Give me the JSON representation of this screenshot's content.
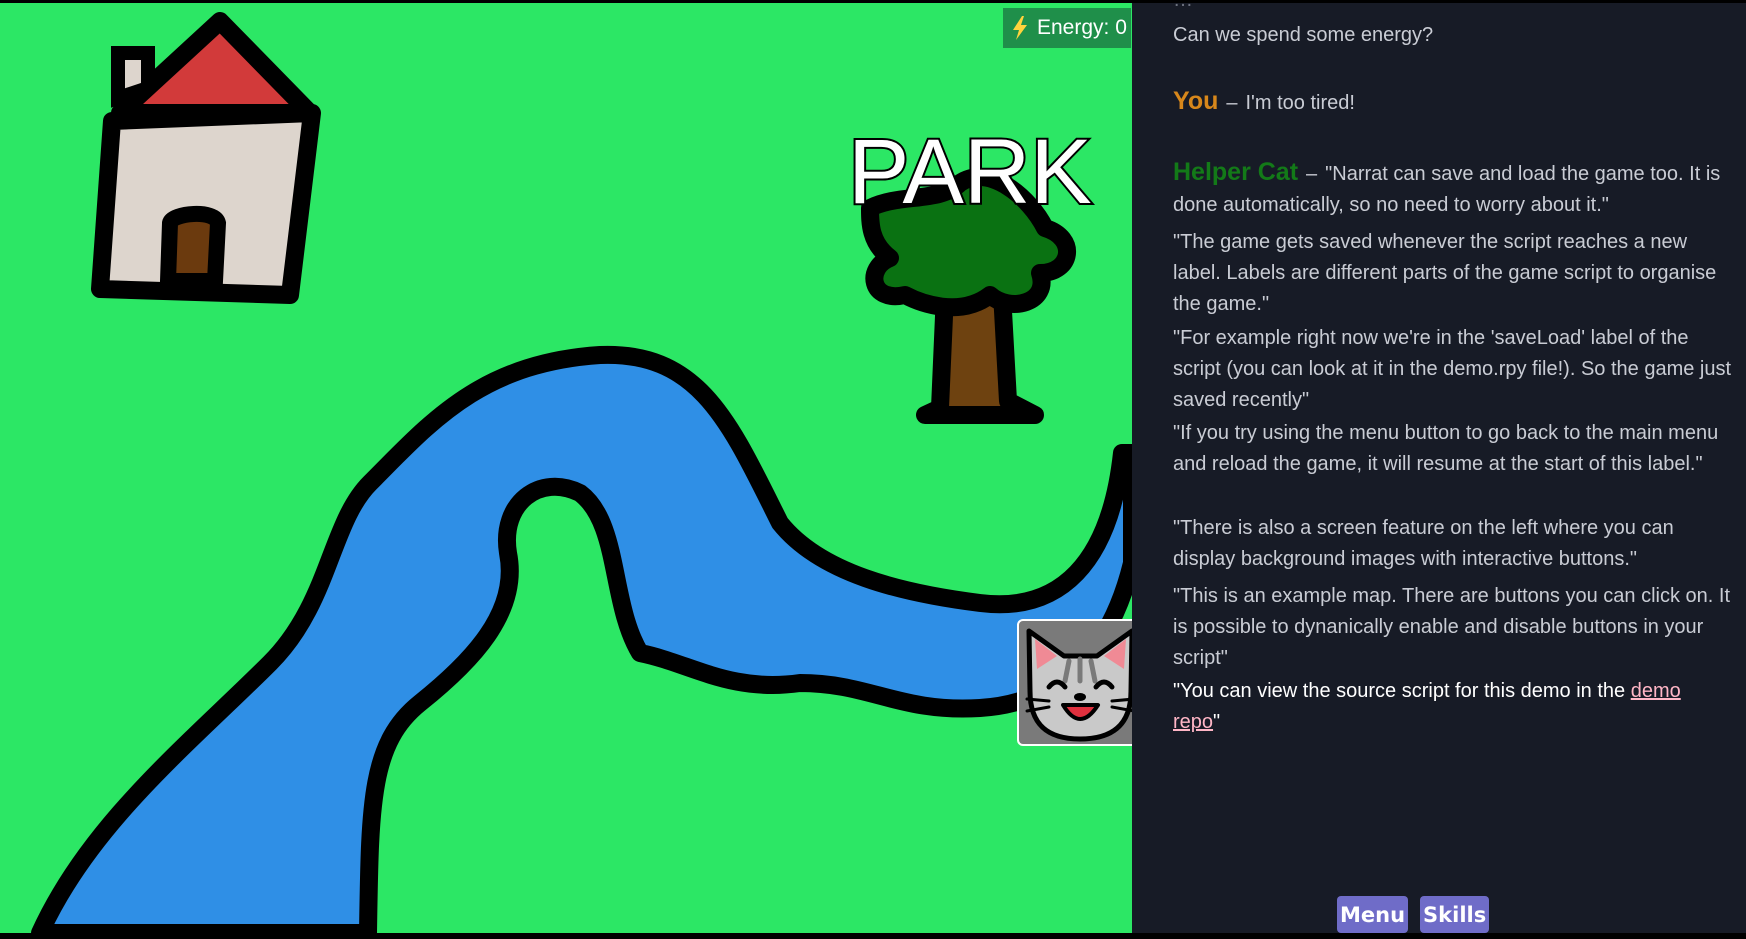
{
  "hud": {
    "energy_label": "Energy: 0",
    "icon": "lightning-bolt-icon",
    "bolt_color": "#ffd33d"
  },
  "map": {
    "park_label": "PARK",
    "ground_color": "#2ce765",
    "river_color": "#2f8fe6",
    "roof_color": "#d23a3a",
    "house_wall_color": "#ddd5cd",
    "door_color": "#6b3a0e",
    "tree_leaf_color": "#0a7212",
    "tree_trunk_color": "#6e4210",
    "character_button_icon": "cat-face-icon"
  },
  "dialogue": [
    {
      "speaker": "",
      "text": "Can we spend some energy?"
    },
    {
      "speaker": "You",
      "speaker_color": "#d7871b",
      "text": "I'm too tired!"
    },
    {
      "speaker": "Helper Cat",
      "speaker_color": "#137a18",
      "text": "\"Narrat can save and load the game too. It is done automatically, so no need to worry about it.\""
    },
    {
      "speaker": "",
      "text": "\"The game gets saved whenever the script reaches a new label. Labels are different parts of the game script to organise the game.\""
    },
    {
      "speaker": "",
      "text": "\"For example right now we're in the 'saveLoad' label of the script (you can look at it in the demo.rpy file!). So the game just saved recently\""
    },
    {
      "speaker": "",
      "text": "\"If you try using the menu button to go back to the main menu and reload the game, it will resume at the start of this label.\""
    },
    {
      "speaker": "",
      "text": "\"There is also a screen feature on the left where you can display background images with interactive buttons.\""
    },
    {
      "speaker": "",
      "text": "\"This is an example map. There are buttons you can click on. It is possible to dynanically enable and disable buttons in your script\""
    },
    {
      "speaker": "",
      "text_before": "\"You can view the source script for this demo in the ",
      "link": "demo repo",
      "text_after": "\""
    }
  ],
  "controls": {
    "menu": "Menu",
    "skills": "Skills"
  }
}
